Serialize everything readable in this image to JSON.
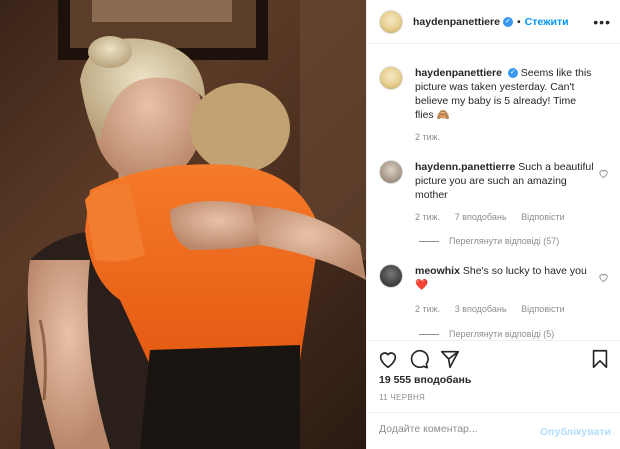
{
  "header": {
    "username": "haydenpanettiere",
    "separator": "•",
    "follow_label": "Стежити",
    "more_label": "•••"
  },
  "caption": {
    "username": "haydenpanettiere",
    "text": "Seems like this picture was taken yesterday. Can't believe my baby is 5 already! Time flies 🙈",
    "time": "2 тиж."
  },
  "comments": [
    {
      "username": "haydenn.panettierre",
      "text": "Such a beautiful picture you are such an amazing mother",
      "time": "2 тиж.",
      "likes": "7 вподобань",
      "reply_label": "Відповісти",
      "view_replies": "Переглянути відповіді (57)"
    },
    {
      "username": "meowhix",
      "text": "She's so lucky to have you❤️",
      "time": "2 тиж.",
      "likes": "3 вподобань",
      "reply_label": "Відповісти",
      "view_replies": "Переглянути відповіді (5)"
    }
  ],
  "stats": {
    "likes": "19 555 вподобань",
    "date": "11 ЧЕРВНЯ"
  },
  "add_comment": {
    "placeholder": "Додайте коментар...",
    "post_label": "Опублікувати"
  },
  "colors": {
    "link_blue": "#0095f6",
    "verified_blue": "#3897f0",
    "muted": "#8e8e8e",
    "hoodie_orange": "#f26a1b"
  },
  "icons": [
    "verified-badge-icon",
    "more-options-icon",
    "heart-icon",
    "comment-icon",
    "share-icon",
    "bookmark-icon"
  ]
}
